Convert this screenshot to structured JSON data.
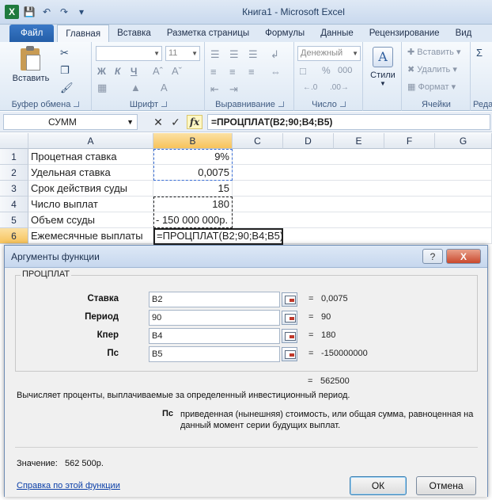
{
  "window": {
    "title": "Книга1  -  Microsoft Excel"
  },
  "qat": {
    "logo": "X",
    "icons": [
      "save-icon",
      "undo-icon",
      "redo-icon",
      "customize-icon"
    ]
  },
  "tabs": [
    "Файл",
    "Главная",
    "Вставка",
    "Разметка страницы",
    "Формулы",
    "Данные",
    "Рецензирование",
    "Вид"
  ],
  "ribbon": {
    "clipboard": {
      "paste": "Вставить",
      "label": "Буфер обмена"
    },
    "font": {
      "size": "11",
      "label": "Шрифт",
      "bold": "Ж",
      "italic": "К",
      "underline": "Ч"
    },
    "alignment": {
      "label": "Выравнивание"
    },
    "number": {
      "format": "Денежный",
      "label": "Число",
      "percent": "%",
      "thousands": "000"
    },
    "styles": {
      "styles": "Стили"
    },
    "cells": {
      "insert": "Вставить",
      "delete": "Удалить",
      "format": "Формат",
      "label": "Ячейки"
    },
    "editing": {
      "label": "Реда"
    }
  },
  "formula_bar": {
    "name_box": "СУММ",
    "fx": "fx",
    "formula": "=ПРОЦПЛАТ(B2;90;B4;B5)"
  },
  "grid": {
    "columns": [
      "A",
      "B",
      "C",
      "D",
      "E",
      "F",
      "G"
    ],
    "rows": [
      {
        "n": "1",
        "a": "Процетная ставка",
        "b": "9%"
      },
      {
        "n": "2",
        "a": "Удельная ставка",
        "b": "0,0075"
      },
      {
        "n": "3",
        "a": "Срок действия суды",
        "b": "15"
      },
      {
        "n": "4",
        "a": "Число выплат",
        "b": "180"
      },
      {
        "n": "5",
        "a": "Объем ссуды",
        "b": "- 150 000 000р."
      },
      {
        "n": "6",
        "a": "Ежемесячные выплаты",
        "b": "=ПРОЦПЛАТ(B2;90;B4;B5)"
      }
    ]
  },
  "dialog": {
    "title": "Аргументы функции",
    "help_btn": "?",
    "close_btn": "X",
    "function_name": "ПРОЦПЛАТ",
    "args": [
      {
        "label": "Ставка",
        "value": "B2",
        "result": "0,0075"
      },
      {
        "label": "Период",
        "value": "90",
        "result": "90"
      },
      {
        "label": "Кпер",
        "value": "B4",
        "result": "180"
      },
      {
        "label": "Пс",
        "value": "B5",
        "result": "-150000000"
      }
    ],
    "eq": "=",
    "total_result": "562500",
    "description": "Вычисляет проценты, выплачиваемые за определенный инвестиционный период.",
    "param_label": "Пс",
    "param_description": "приведенная (нынешняя) стоимость, или общая сумма, равноценная на данный момент серии будущих выплат.",
    "value_label": "Значение:",
    "value": "562 500р.",
    "help_link": "Справка по этой функции",
    "ok": "ОК",
    "cancel": "Отмена"
  }
}
